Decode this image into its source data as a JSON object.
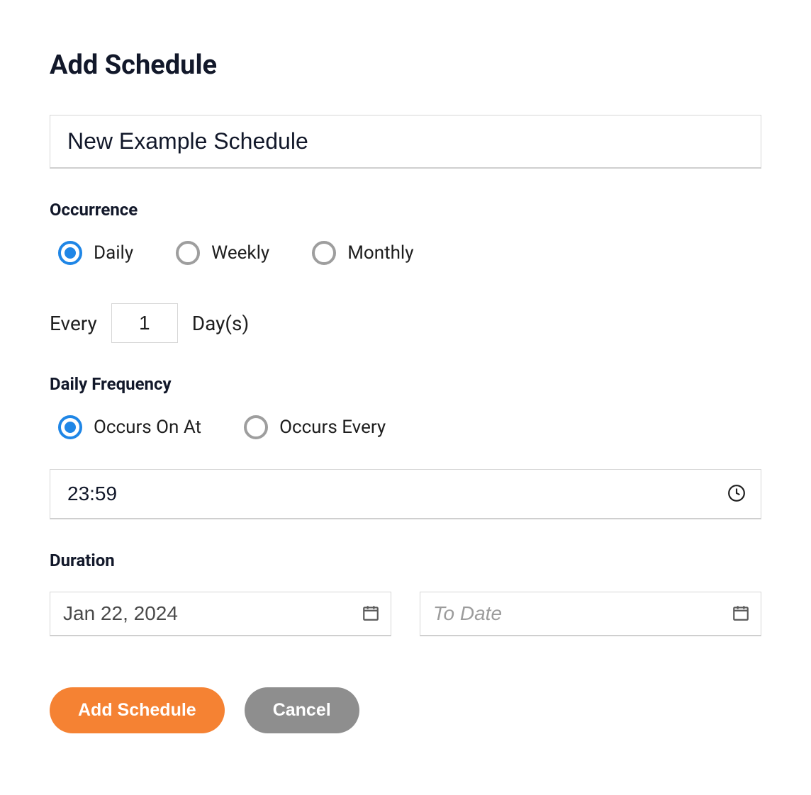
{
  "title": "Add Schedule",
  "scheduleName": "New Example Schedule",
  "occurrence": {
    "label": "Occurrence",
    "options": {
      "daily": "Daily",
      "weekly": "Weekly",
      "monthly": "Monthly"
    },
    "everyPrefix": "Every",
    "everyValue": "1",
    "everySuffix": "Day(s)"
  },
  "dailyFrequency": {
    "label": "Daily Frequency",
    "options": {
      "occursOnAt": "Occurs On At",
      "occursEvery": "Occurs Every"
    },
    "timeValue": "23:59"
  },
  "duration": {
    "label": "Duration",
    "fromDate": "Jan 22, 2024",
    "toDatePlaceholder": "To Date"
  },
  "buttons": {
    "submit": "Add Schedule",
    "cancel": "Cancel"
  }
}
